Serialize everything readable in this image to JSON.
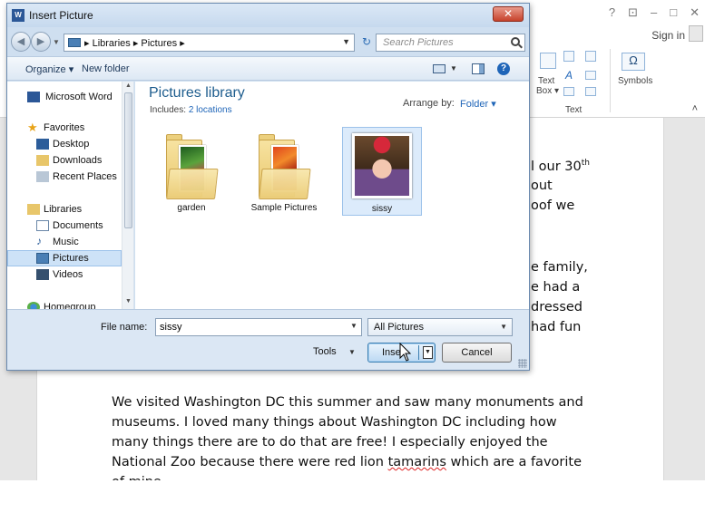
{
  "word": {
    "window_controls": [
      "?",
      "⊡",
      "–",
      "□",
      "✕"
    ],
    "sign_in": "Sign in",
    "ribbon": {
      "text_box_line1": "Text",
      "text_box_line2": "Box ▾",
      "symbols_label": "Symbols",
      "symbol_glyph": "Ω",
      "group_label": "Text",
      "collapse": "˄"
    },
    "doc_fragments": {
      "f1": "l our 30",
      "f1_sup": "th",
      "f2": "out",
      "f3": "oof we",
      "f4": "e family,",
      "f5": "e had a",
      "f6": "dressed",
      "f7": "had fun"
    },
    "paragraph": {
      "line1": "We visited Washington DC this summer and saw many monuments and",
      "line2": "museums.  I loved many things about Washington DC including how",
      "line3": "many things there are to do that are free!  I especially enjoyed the",
      "line4_pre": "National Zoo because there were red lion ",
      "line4_spell": "tamarins",
      "line4_post": " which are a favorite",
      "line5": "of mine."
    }
  },
  "dialog": {
    "title": "Insert Picture",
    "title_icon": "W",
    "close": "✕",
    "address": "▸ Libraries ▸ Pictures ▸",
    "search_placeholder": "Search Pictures",
    "organize": "Organize ▾",
    "new_folder": "New folder",
    "help": "?",
    "nav": {
      "items": [
        {
          "label": "Microsoft Word",
          "icon": "word-icon"
        },
        {
          "label": "Favorites",
          "icon": "star-icon"
        },
        {
          "label": "Desktop",
          "icon": "desktop-icon"
        },
        {
          "label": "Downloads",
          "icon": "downloads-icon"
        },
        {
          "label": "Recent Places",
          "icon": "recent-places-icon"
        },
        {
          "label": "Libraries",
          "icon": "libraries-icon"
        },
        {
          "label": "Documents",
          "icon": "documents-icon"
        },
        {
          "label": "Music",
          "icon": "music-icon"
        },
        {
          "label": "Pictures",
          "icon": "pictures-icon"
        },
        {
          "label": "Videos",
          "icon": "videos-icon"
        },
        {
          "label": "Homegroup",
          "icon": "homegroup-icon"
        }
      ],
      "selected": "Pictures"
    },
    "library": {
      "title": "Pictures library",
      "includes_label": "Includes: ",
      "includes_link": "2 locations",
      "arrange_label": "Arrange by:",
      "arrange_value": "Folder ▾"
    },
    "files": [
      {
        "name": "garden",
        "type": "folder"
      },
      {
        "name": "Sample Pictures",
        "type": "folder"
      },
      {
        "name": "sissy",
        "type": "image",
        "selected": true
      }
    ],
    "file_name_label": "File name:",
    "file_name_value": "sissy",
    "file_type_filter": "All Pictures",
    "tools": "Tools",
    "insert": "Insert",
    "cancel": "Cancel"
  },
  "colors": {
    "accent": "#1e5d8e",
    "link": "#1f65b8",
    "selection": "#cde2f7",
    "close_red": "#c6422b"
  }
}
